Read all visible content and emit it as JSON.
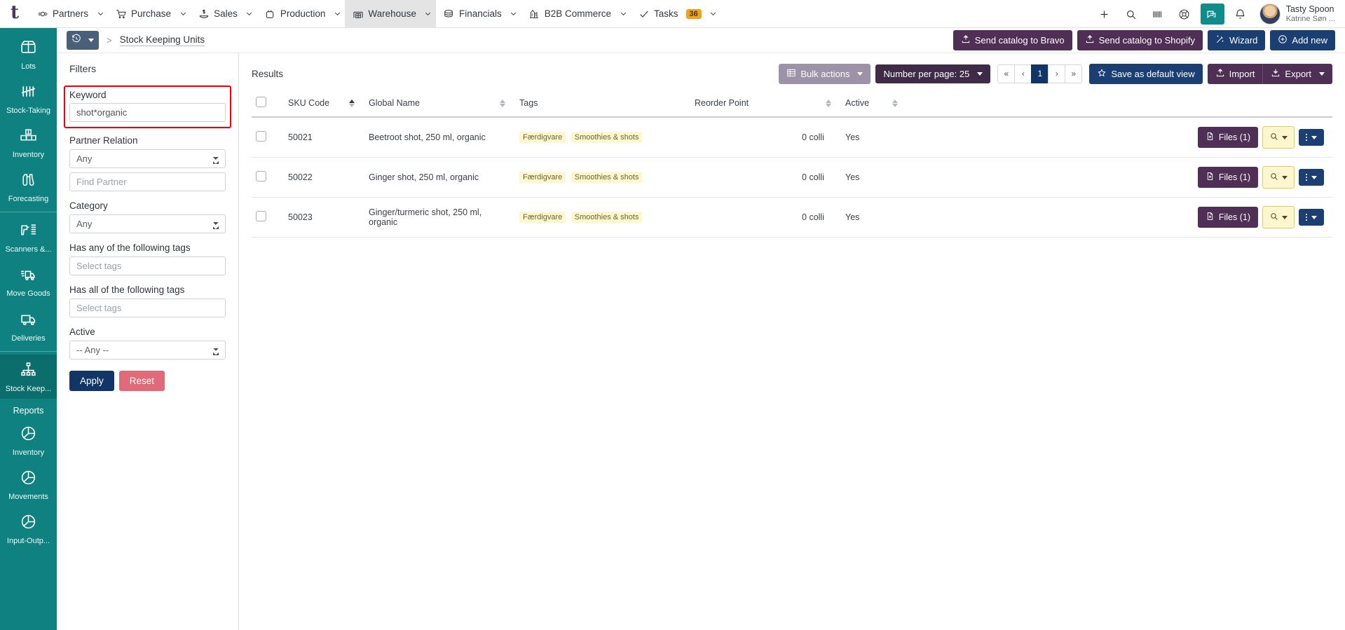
{
  "app": {
    "logo_letter": "t"
  },
  "topnav": {
    "items": [
      {
        "label": "Partners",
        "icon": "partners-icon",
        "active": false,
        "has_caret": true
      },
      {
        "label": "Purchase",
        "icon": "cart-icon",
        "active": false,
        "has_caret": true
      },
      {
        "label": "Sales",
        "icon": "sales-icon",
        "active": false,
        "has_caret": true
      },
      {
        "label": "Production",
        "icon": "production-icon",
        "active": false,
        "has_caret": true
      },
      {
        "label": "Warehouse",
        "icon": "warehouse-icon",
        "active": true,
        "has_caret": true
      },
      {
        "label": "Financials",
        "icon": "coins-icon",
        "active": false,
        "has_caret": true
      },
      {
        "label": "B2B Commerce",
        "icon": "b2b-icon",
        "active": false,
        "has_caret": true
      },
      {
        "label": "Tasks",
        "icon": "check-icon",
        "active": false,
        "has_caret": true,
        "badge": "36"
      }
    ],
    "actions": [
      {
        "name": "add-icon"
      },
      {
        "name": "search-icon"
      },
      {
        "name": "barcode-icon"
      },
      {
        "name": "lifering-icon"
      },
      {
        "name": "chat-icon"
      },
      {
        "name": "bell-icon"
      }
    ],
    "user": {
      "name": "Tasty Spoon",
      "sub": "Katrine Søn ..."
    },
    "accent_teal": "#0f8c8c",
    "badge_color": "#f4a118"
  },
  "subheader": {
    "history_icon": "history-icon",
    "history_caret": true,
    "separator": ">",
    "breadcrumb_current": "Stock Keeping Units",
    "buttons": [
      {
        "label": "Send catalog to Bravo",
        "icon": "upload-icon",
        "style": "purple"
      },
      {
        "label": "Send catalog to Shopify",
        "icon": "upload-icon",
        "style": "purple"
      },
      {
        "label": "Wizard",
        "icon": "wand-icon",
        "style": "navy"
      },
      {
        "label": "Add new",
        "icon": "plus-circle-icon",
        "style": "navy"
      }
    ]
  },
  "sidebar": {
    "items": [
      {
        "label": "Lots",
        "icon": "box-icon",
        "active": false
      },
      {
        "label": "Stock-Taking",
        "icon": "tally-icon",
        "active": false
      },
      {
        "label": "Inventory",
        "icon": "boxes-icon",
        "active": false
      },
      {
        "label": "Forecasting",
        "icon": "binoculars-icon",
        "active": false
      },
      {
        "sep": true
      },
      {
        "label": "Scanners &...",
        "icon": "scanner-icon",
        "active": false
      },
      {
        "label": "Move Goods",
        "icon": "move-truck-icon",
        "active": false
      },
      {
        "label": "Deliveries",
        "icon": "truck-icon",
        "active": false
      },
      {
        "sep": true
      },
      {
        "label": "Stock Keep...",
        "icon": "sitemap-icon",
        "active": true
      },
      {
        "heading": "Reports"
      },
      {
        "label": "Inventory",
        "icon": "piechart-icon",
        "active": false
      },
      {
        "label": "Movements",
        "icon": "piechart-icon",
        "active": false
      },
      {
        "label": "Input-Outp...",
        "icon": "piechart-icon",
        "active": false
      }
    ]
  },
  "filters": {
    "title": "Filters",
    "keyword": {
      "label": "Keyword",
      "value": "shot*organic",
      "highlighted": true,
      "highlight_color": "#f3000c"
    },
    "partner_relation": {
      "label": "Partner Relation",
      "selected": "Any",
      "options": [
        "Any"
      ],
      "find_partner_placeholder": "Find Partner",
      "find_partner_value": ""
    },
    "category": {
      "label": "Category",
      "selected": "Any",
      "options": [
        "Any"
      ]
    },
    "has_any_tags": {
      "label": "Has any of the following tags",
      "placeholder": "Select tags",
      "value": ""
    },
    "has_all_tags": {
      "label": "Has all of the following tags",
      "placeholder": "Select tags",
      "value": ""
    },
    "active": {
      "label": "Active",
      "selected": "-- Any --",
      "options": [
        "-- Any --"
      ]
    },
    "apply_label": "Apply",
    "reset_label": "Reset"
  },
  "results": {
    "title": "Results",
    "toolbar": {
      "bulk_actions_label": "Bulk actions",
      "number_per_page_label": "Number per page: 25",
      "pager": [
        "«",
        "‹",
        "1",
        "›",
        "»"
      ],
      "pager_current": "1",
      "save_default_label": "Save as default view",
      "import_label": "Import",
      "export_label": "Export"
    },
    "columns": [
      {
        "label": "SKU Code",
        "sort": "asc"
      },
      {
        "label": "Global Name",
        "sort": "none"
      },
      {
        "label": "Tags",
        "sort": "none"
      },
      {
        "label": "Reorder Point",
        "sort": "none"
      },
      {
        "label": "Active",
        "sort": "none"
      }
    ],
    "rows": [
      {
        "sku": "50021",
        "name": "Beetroot shot, 250 ml, organic",
        "tags": [
          "Færdigvare",
          "Smoothies & shots"
        ],
        "reorder_point": "0 colli",
        "active": "Yes",
        "files_label": "Files (1)"
      },
      {
        "sku": "50022",
        "name": "Ginger shot, 250 ml, organic",
        "tags": [
          "Færdigvare",
          "Smoothies & shots"
        ],
        "reorder_point": "0 colli",
        "active": "Yes",
        "files_label": "Files (1)"
      },
      {
        "sku": "50023",
        "name": "Ginger/turmeric shot, 250 ml, organic",
        "tags": [
          "Færdigvare",
          "Smoothies & shots"
        ],
        "reorder_point": "0 colli",
        "active": "Yes",
        "files_label": "Files (1)"
      }
    ]
  }
}
